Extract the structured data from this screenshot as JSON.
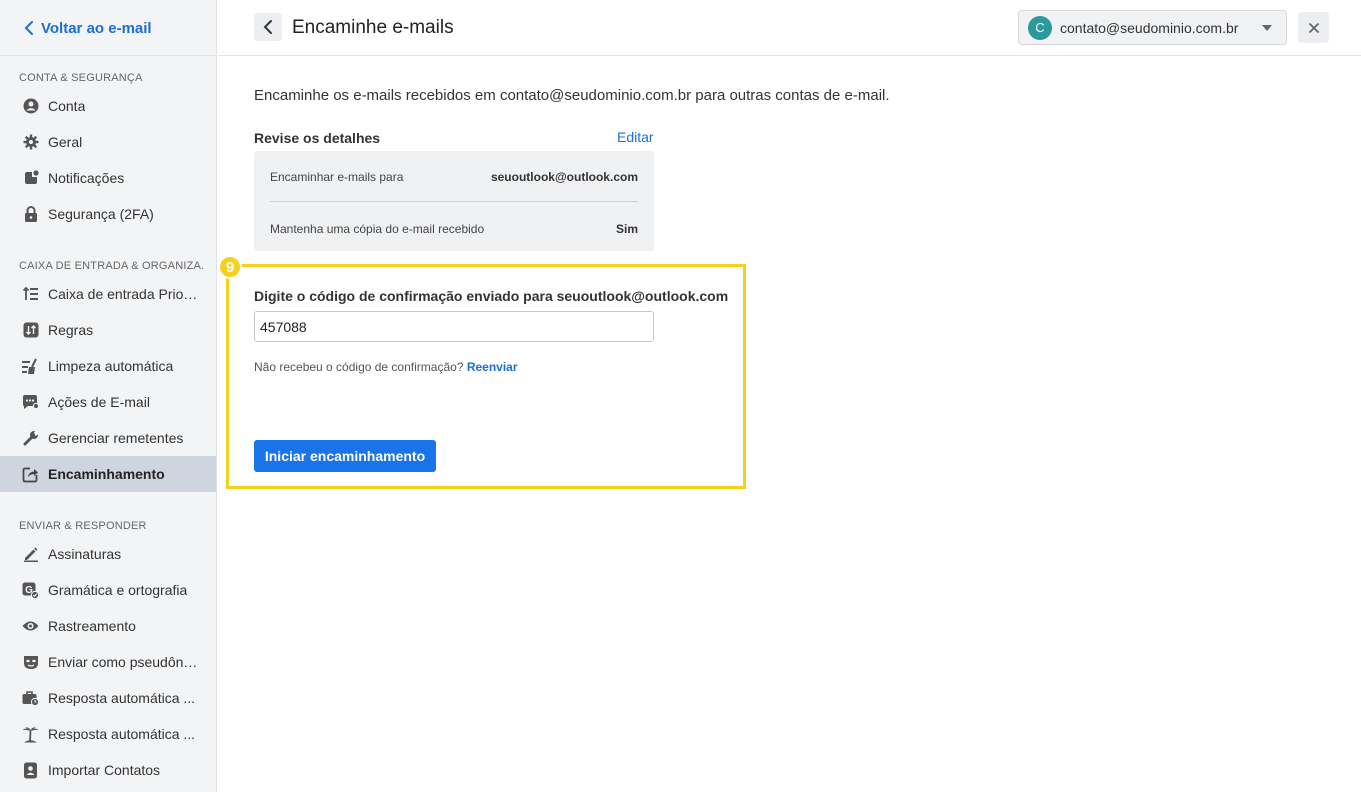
{
  "sidebar": {
    "back_label": "Voltar ao e-mail",
    "sections": [
      {
        "title": "CONTA & SEGURANÇA",
        "items": [
          {
            "label": "Conta",
            "icon": "account-circle-icon"
          },
          {
            "label": "Geral",
            "icon": "gear-icon"
          },
          {
            "label": "Notificações",
            "icon": "notification-icon"
          },
          {
            "label": "Segurança (2FA)",
            "icon": "lock-icon"
          }
        ]
      },
      {
        "title": "CAIXA DE ENTRADA & ORGANIZAÇÃO",
        "items": [
          {
            "label": "Caixa de entrada Prioritária",
            "icon": "priority-inbox-icon"
          },
          {
            "label": "Regras",
            "icon": "rules-icon"
          },
          {
            "label": "Limpeza automática",
            "icon": "sweep-icon"
          },
          {
            "label": "Ações de E-mail",
            "icon": "email-actions-icon"
          },
          {
            "label": "Gerenciar remetentes",
            "icon": "wrench-icon"
          },
          {
            "label": "Encaminhamento",
            "icon": "forward-icon",
            "active": true
          }
        ]
      },
      {
        "title": "ENVIAR & RESPONDER",
        "items": [
          {
            "label": "Assinaturas",
            "icon": "pen-icon"
          },
          {
            "label": "Gramática e ortografia",
            "icon": "grammar-icon"
          },
          {
            "label": "Rastreamento",
            "icon": "eye-icon"
          },
          {
            "label": "Enviar como pseudônimo",
            "icon": "mask-icon"
          },
          {
            "label": "Resposta automática de negócios",
            "icon": "briefcase-icon"
          },
          {
            "label": "Resposta automática de férias",
            "icon": "palm-tree-icon"
          },
          {
            "label": "Importar Contatos",
            "icon": "contacts-icon"
          }
        ]
      }
    ]
  },
  "header": {
    "title": "Encaminhe e-mails",
    "account_initial": "C",
    "account_email": "contato@seudominio.com.br"
  },
  "main": {
    "intro": "Encaminhe os e-mails recebidos em contato@seudominio.com.br para outras contas de e-mail.",
    "review_title": "Revise os detalhes",
    "edit_label": "Editar",
    "details": [
      {
        "label": "Encaminhar e-mails para",
        "value": "seuoutlook@outlook.com"
      },
      {
        "label": "Mantenha uma cópia do e-mail recebido",
        "value": "Sim"
      }
    ],
    "step_badge": "9",
    "code_label": "Digite o código de confirmação enviado para seuoutlook@outlook.com",
    "code_value": "457088",
    "resend_text": "Não recebeu o código de confirmação?",
    "resend_link": "Reenviar",
    "start_button": "Iniciar encaminhamento"
  },
  "colors": {
    "accent": "#1a73e8",
    "link": "#1a6fd9",
    "highlight": "#f5d01f",
    "avatar": "#2a9a9c",
    "active_item": "#cfd5de"
  }
}
